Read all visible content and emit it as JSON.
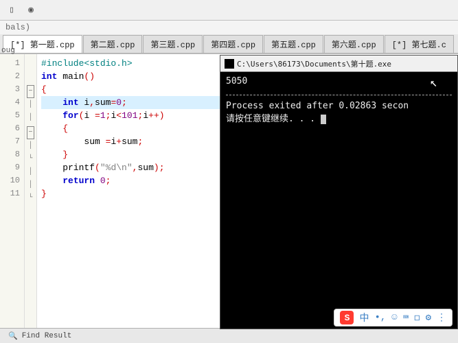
{
  "globals_label": "bals)",
  "side_label": "oug",
  "tabs": [
    {
      "label": "[*] 第一题.cpp",
      "active": true
    },
    {
      "label": "第二题.cpp"
    },
    {
      "label": "第三题.cpp"
    },
    {
      "label": "第四题.cpp"
    },
    {
      "label": "第五题.cpp"
    },
    {
      "label": "第六题.cpp"
    },
    {
      "label": "[*] 第七题.c"
    }
  ],
  "code": {
    "lines": [
      {
        "n": "1"
      },
      {
        "n": "2"
      },
      {
        "n": "3"
      },
      {
        "n": "4"
      },
      {
        "n": "5"
      },
      {
        "n": "6"
      },
      {
        "n": "7"
      },
      {
        "n": "8"
      },
      {
        "n": "9"
      },
      {
        "n": "10"
      },
      {
        "n": "11"
      }
    ],
    "l1_include": "#include",
    "l1_header": "<stdio.h>",
    "l2_int": "int",
    "l2_main": " main",
    "l2_paren": "()",
    "l3_brace": "{",
    "l4_int": "int",
    "l4_rest1": " i",
    "l4_comma": ",",
    "l4_rest2": "sum",
    "l4_eq": "=",
    "l4_zero": "0",
    "l4_semi": ";",
    "l5_for": "for",
    "l5_open": "(",
    "l5_body1": "i ",
    "l5_eq1": "=",
    "l5_one": "1",
    "l5_semi1": ";",
    "l5_body2": "i",
    "l5_lt": "<",
    "l5_101": "101",
    "l5_semi2": ";",
    "l5_body3": "i",
    "l5_pp": "++",
    "l5_close": ")",
    "l6_brace": "{",
    "l7_body1": "sum ",
    "l7_eq": "=",
    "l7_body2": "i",
    "l7_plus": "+",
    "l7_body3": "sum",
    "l7_semi": ";",
    "l8_brace": "}",
    "l9_printf": "printf",
    "l9_open": "(",
    "l9_str": "\"%d\\n\"",
    "l9_comma": ",",
    "l9_arg": "sum",
    "l9_close": ")",
    "l9_semi": ";",
    "l10_return": "return",
    "l10_zero": " 0",
    "l10_semi": ";",
    "l11_brace": "}"
  },
  "console": {
    "title": "C:\\Users\\86173\\Documents\\第十题.exe",
    "output": "5050",
    "exit_line": "Process exited after 0.02863 secon",
    "press_key": "请按任意键继续. . . "
  },
  "ime": {
    "logo": "S",
    "items": [
      "中",
      "•,",
      "☺",
      "⌨",
      "◻",
      "⚙",
      "⋮"
    ]
  },
  "bottom": {
    "find_icon": "🔍",
    "find_label": "Find Result"
  }
}
